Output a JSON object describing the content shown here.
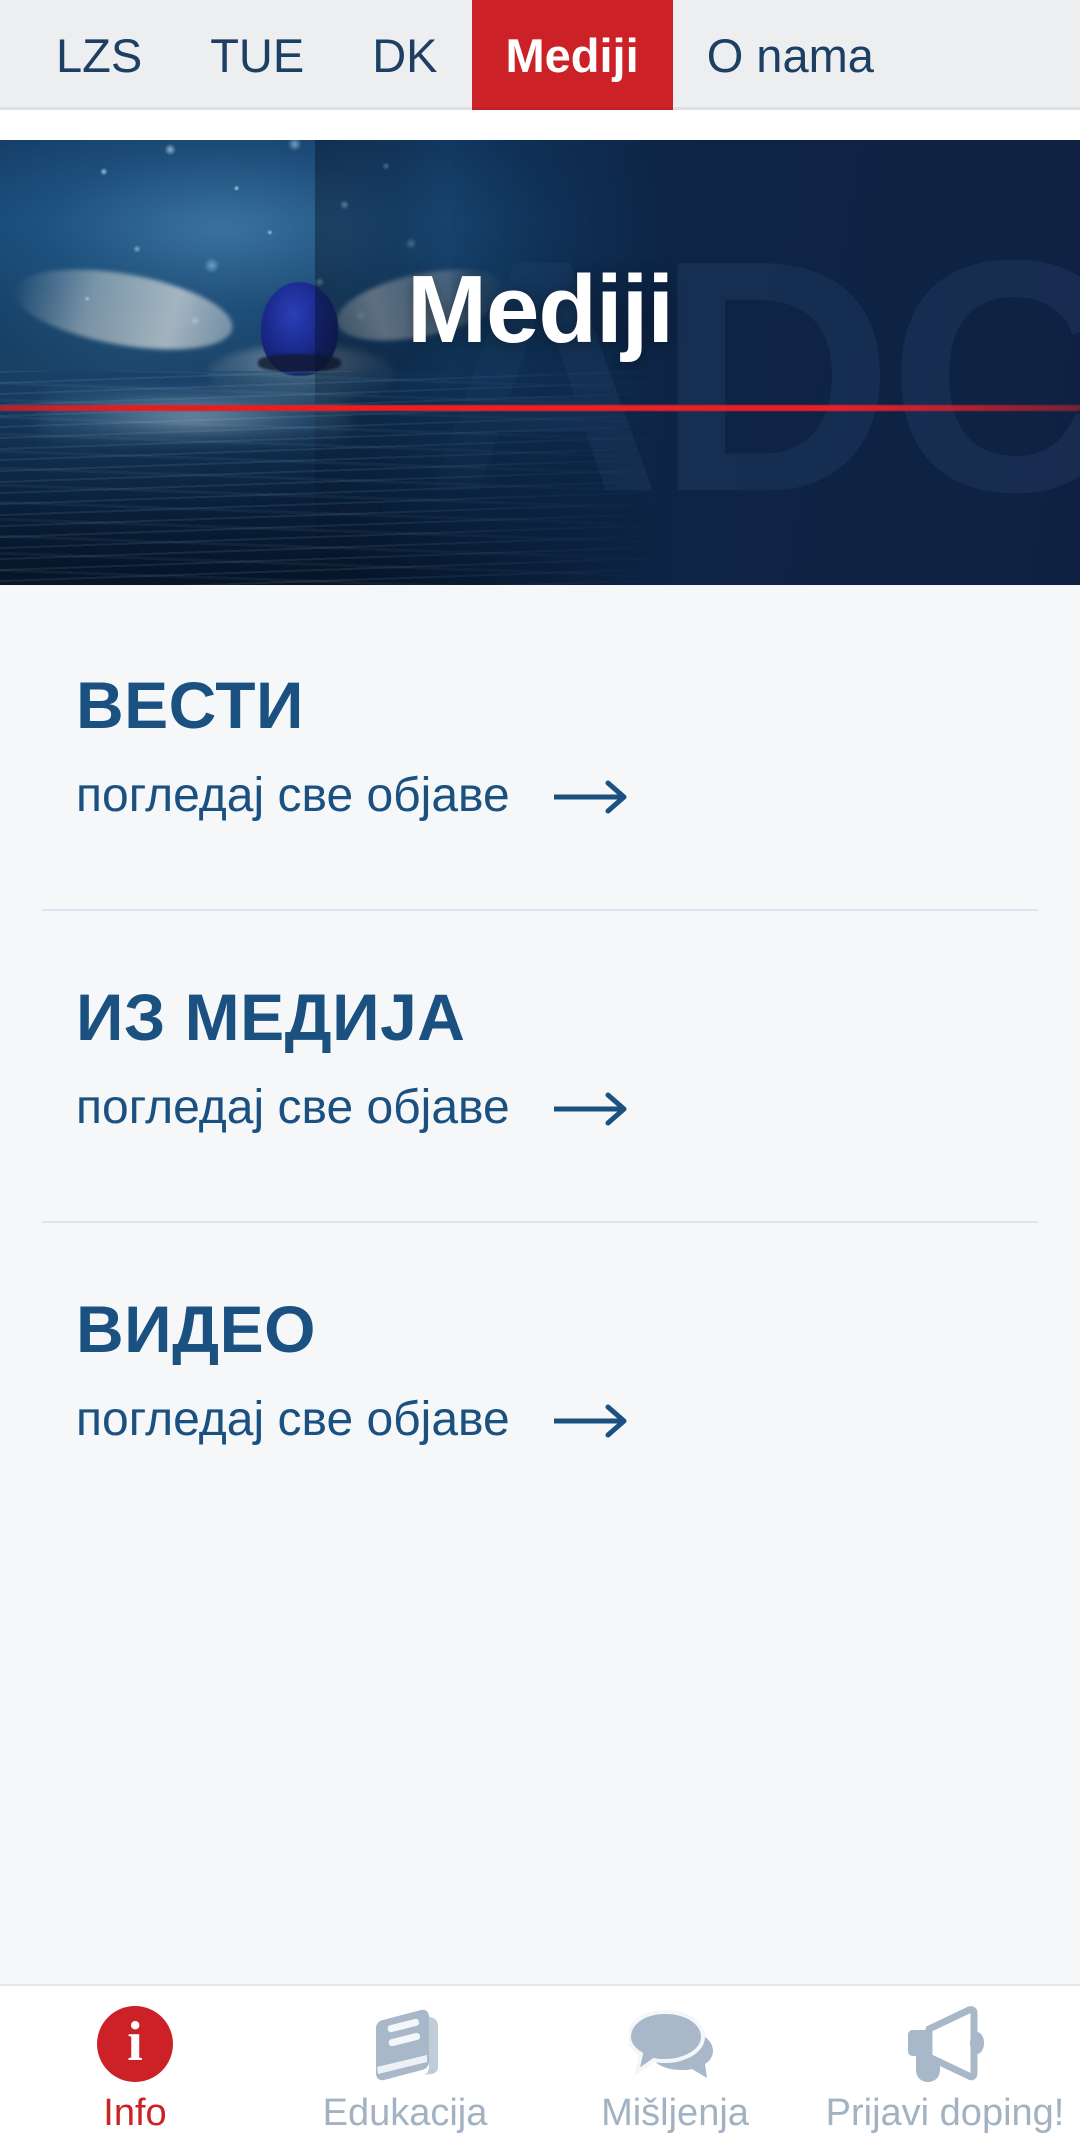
{
  "topnav": {
    "items": [
      {
        "label": "LZS",
        "active": false
      },
      {
        "label": "TUE",
        "active": false
      },
      {
        "label": "DK",
        "active": false
      },
      {
        "label": "Mediji",
        "active": true
      },
      {
        "label": "O nama",
        "active": false
      }
    ],
    "active_bg": "#cc2127",
    "text_color": "#1d3f63",
    "bar_bg": "#eceef0"
  },
  "hero": {
    "title": "Mediji",
    "watermark": "ADC",
    "accent_line_color": "#e11e23",
    "bg_color": "#0d2344",
    "image_alt": "swimmer-butterfly-stroke"
  },
  "sections": [
    {
      "title": "ВЕСТИ",
      "link_label": "погледај све објаве",
      "arrow": "⟶"
    },
    {
      "title": "ИЗ МЕДИЈА",
      "link_label": "погледај све објаве",
      "arrow": "⟶"
    },
    {
      "title": "ВИДЕО",
      "link_label": "погледај све објаве",
      "arrow": "⟶"
    }
  ],
  "theme": {
    "heading_color": "#1b5181",
    "link_color": "#1b5181",
    "page_bg": "#f5f7f9",
    "divider_color": "#dde7f1"
  },
  "tabbar": {
    "items": [
      {
        "label": "Info",
        "icon": "info-circle-icon",
        "active": true
      },
      {
        "label": "Edukacija",
        "icon": "book-icon",
        "active": false
      },
      {
        "label": "Mišljenja",
        "icon": "speech-bubbles-icon",
        "active": false
      },
      {
        "label": "Prijavi doping!",
        "icon": "megaphone-icon",
        "active": false
      }
    ],
    "info_glyph": "i",
    "active_color": "#cc2127",
    "inactive_color": "#a3b2c2"
  }
}
